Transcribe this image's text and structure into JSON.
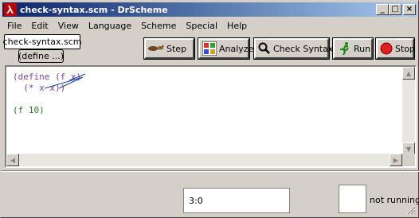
{
  "window": {
    "title": "check-syntax.scm - DrScheme",
    "controls": {
      "minimize": "_",
      "maximize": "□",
      "close": "×"
    }
  },
  "menu": [
    "File",
    "Edit",
    "View",
    "Language",
    "Scheme",
    "Special",
    "Help"
  ],
  "file_label": "check-syntax.scm",
  "define_popup": "(define ...)",
  "toolbar": {
    "step": "Step",
    "analyze": "Analyze",
    "check_syntax": "Check Syntax",
    "run": "Run",
    "stop": "Stop"
  },
  "editor": {
    "line1_kw": "(define ",
    "line1_rest": "(f x)",
    "line2": "  (* x x))",
    "line3": "(f 10)"
  },
  "status": {
    "position": "3:0",
    "running": "not running"
  },
  "colors": {
    "keyword": "#7f3f9f",
    "identifier": "#2d7a2d",
    "arrow": "#2040a0",
    "title_start": "#0a246a",
    "title_end": "#a6caf0"
  }
}
